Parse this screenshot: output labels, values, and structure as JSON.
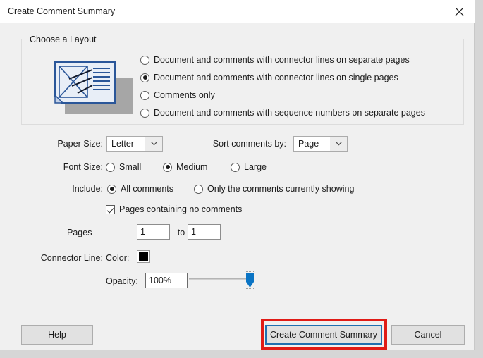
{
  "window": {
    "title": "Create Comment Summary",
    "close_icon": "close-icon"
  },
  "layout_group": {
    "legend": "Choose a Layout",
    "preview_icon": "document-comments-preview-icon",
    "options": [
      {
        "label": "Document and comments with connector lines on separate pages",
        "selected": false
      },
      {
        "label": "Document and comments with connector lines on single pages",
        "selected": true
      },
      {
        "label": "Comments only",
        "selected": false
      },
      {
        "label": "Document and comments with sequence numbers on separate pages",
        "selected": false
      }
    ]
  },
  "paper_size": {
    "label": "Paper Size:",
    "value": "Letter",
    "arrow_icon": "chevron-down-icon"
  },
  "sort_comments": {
    "label": "Sort comments by:",
    "value": "Page",
    "arrow_icon": "chevron-down-icon"
  },
  "font_size": {
    "label": "Font Size:",
    "options": [
      {
        "label": "Small",
        "selected": false
      },
      {
        "label": "Medium",
        "selected": true
      },
      {
        "label": "Large",
        "selected": false
      }
    ]
  },
  "include": {
    "label": "Include:",
    "options": [
      {
        "label": "All comments",
        "selected": true
      },
      {
        "label": "Only the comments currently showing",
        "selected": false
      }
    ],
    "checkbox": {
      "label": "Pages containing no comments",
      "checked": true
    }
  },
  "pages": {
    "label": "Pages",
    "from_value": "1",
    "to_label": "to",
    "to_value": "1"
  },
  "connector_line": {
    "label": "Connector Line:",
    "color_label": "Color:",
    "color_value": "#000000",
    "opacity_label": "Opacity:",
    "opacity_value": "100%",
    "slider_position_percent": 100
  },
  "buttons": {
    "help": "Help",
    "create": "Create Comment Summary",
    "cancel": "Cancel"
  },
  "annotation": {
    "highlight_color": "#e01b16",
    "focus_color": "#1f6fb0"
  }
}
